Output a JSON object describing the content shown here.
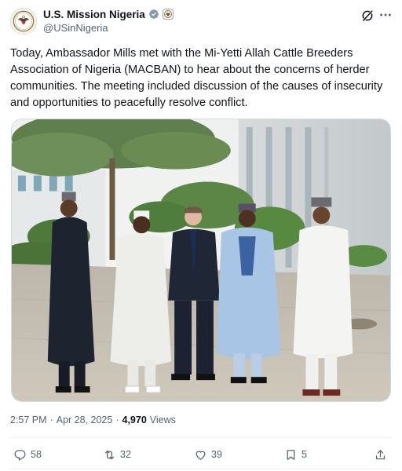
{
  "author": {
    "display_name": "U.S. Mission Nigeria",
    "handle": "@USinNigeria",
    "avatar_icon": "us-embassy-seal-icon",
    "verified_icon": "verified-badge-icon",
    "affiliation_icon": "government-badge-icon"
  },
  "header_actions": {
    "grok_icon": "grok-icon",
    "more_icon": "more-options-icon"
  },
  "tweet": {
    "text": "Today, Ambassador Mills met with the Mi-Yetti Allah Cattle Breeders Association of Nigeria (MACBAN) to hear about the concerns of herder communities.  The meeting included discussion of the causes of insecurity and opportunities to peacefully resolve conflict."
  },
  "meta": {
    "time": "2:57 PM",
    "separator": "·",
    "date": "Apr 28, 2025",
    "separator2": "·",
    "views_count": "4,970",
    "views_label": "Views"
  },
  "actions": {
    "reply": {
      "count": "58",
      "icon": "reply-icon"
    },
    "repost": {
      "count": "32",
      "icon": "repost-icon"
    },
    "like": {
      "count": "39",
      "icon": "like-icon"
    },
    "bookmark": {
      "count": "5",
      "icon": "bookmark-icon"
    },
    "share": {
      "icon": "share-icon"
    }
  },
  "colors": {
    "text_primary": "#0f1419",
    "text_secondary": "#536471",
    "verified_blue": "#1d9bf0",
    "divider": "#eff3f4"
  }
}
